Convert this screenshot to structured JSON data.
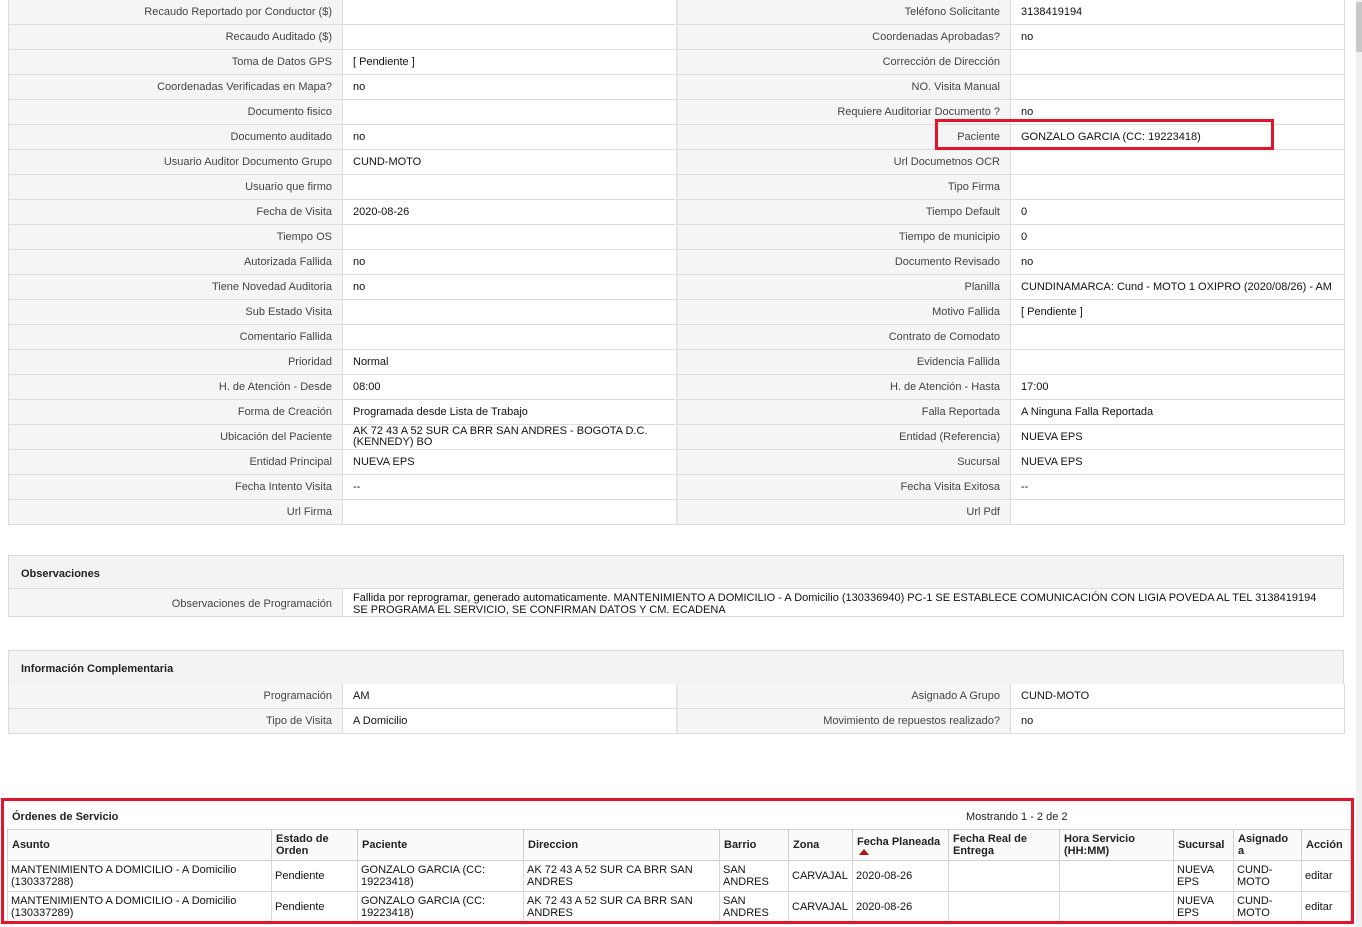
{
  "details": [
    [
      "Recaudo Reportado por Conductor ($)",
      "",
      "Teléfono Solicitante",
      "3138419194"
    ],
    [
      "Recaudo Auditado ($)",
      "",
      "Coordenadas Aprobadas?",
      " no"
    ],
    [
      "Toma de Datos GPS",
      "[ Pendiente ]",
      "Corrección de Dirección",
      ""
    ],
    [
      "Coordenadas Verificadas en Mapa?",
      " no",
      "NO. Visita Manual",
      ""
    ],
    [
      "Documento fisico",
      "",
      "Requiere Auditoriar Documento ?",
      " no"
    ],
    [
      "Documento auditado",
      " no",
      "Paciente",
      "GONZALO GARCIA (CC: 19223418)"
    ],
    [
      "Usuario Auditor Documento Grupo",
      "CUND-MOTO",
      "Url Documetnos OCR",
      ""
    ],
    [
      "Usuario que firmo",
      "",
      "Tipo Firma",
      ""
    ],
    [
      "Fecha de Visita",
      " 2020-08-26",
      "Tiempo Default",
      "0"
    ],
    [
      "Tiempo OS",
      "",
      "Tiempo de municipio",
      "0"
    ],
    [
      "Autorizada Fallida",
      " no",
      "Documento Revisado",
      " no"
    ],
    [
      "Tiene Novedad Auditoria",
      " no",
      "Planilla",
      "CUNDINAMARCA: Cund - MOTO 1 OXIPRO (2020/08/26) - AM"
    ],
    [
      "Sub Estado Visita",
      "",
      "Motivo Fallida",
      "[ Pendiente ]"
    ],
    [
      "Comentario Fallida",
      "",
      "Contrato de Comodato",
      ""
    ],
    [
      "Prioridad",
      "Normal",
      "Evidencia Fallida",
      ""
    ],
    [
      "H. de Atención - Desde",
      "08:00",
      "H. de Atención - Hasta",
      "17:00"
    ],
    [
      "Forma de Creación",
      "Programada desde Lista de Trabajo",
      "Falla Reportada",
      "A Ninguna Falla Reportada"
    ],
    [
      "Ubicación del Paciente",
      "AK 72 43 A 52 SUR CA BRR SAN ANDRES - BOGOTA D.C. (KENNEDY) BO",
      "Entidad (Referencia)",
      "NUEVA EPS"
    ],
    [
      "Entidad Principal",
      "NUEVA EPS",
      "Sucursal",
      "NUEVA EPS"
    ],
    [
      "Fecha Intento Visita",
      " --",
      "Fecha Visita Exitosa",
      " --"
    ],
    [
      "Url Firma",
      "",
      "Url Pdf",
      ""
    ]
  ],
  "observaciones": {
    "title": "Observaciones",
    "label": "Observaciones de Programación",
    "value": "  Fallida por reprogramar, generado automaticamente. MANTENIMIENTO A DOMICILIO - A Domicilio (130336940) PC-1 SE ESTABLECE COMUNICACIÓN CON LIGIA POVEDA AL TEL 3138419194 SE PROGRAMA EL SERVICIO, SE CONFIRMAN DATOS Y CM. ECADENA"
  },
  "complementaria": {
    "title": "Información Complementaria",
    "rows": [
      [
        "Programación",
        "AM",
        "Asignado A Grupo",
        "CUND-MOTO"
      ],
      [
        "Tipo de Visita",
        "A Domicilio",
        "Movimiento de repuestos realizado?",
        " no"
      ]
    ]
  },
  "ordenes": {
    "title": "Órdenes de Servicio",
    "count": "Mostrando 1 - 2 de 2",
    "headers": [
      "Asunto",
      "Estado de Orden",
      "Paciente",
      "Direccion",
      "Barrio",
      "Zona",
      "Fecha Planeada",
      "Fecha Real de Entrega",
      "Hora Servicio (HH:MM)",
      "Sucursal",
      "Asignado a",
      "Acción"
    ],
    "rows": [
      [
        "MANTENIMIENTO A DOMICILIO - A Domicilio (130337288)",
        "Pendiente",
        "GONZALO GARCIA (CC: 19223418)",
        "AK 72 43 A 52 SUR CA BRR SAN ANDRES",
        "SAN ANDRES",
        "CARVAJAL",
        "2020-08-26",
        "",
        "",
        "NUEVA EPS",
        "CUND-MOTO",
        "editar"
      ],
      [
        "MANTENIMIENTO A DOMICILIO - A Domicilio (130337289)",
        "Pendiente",
        "GONZALO GARCIA (CC: 19223418)",
        "AK 72 43 A 52 SUR CA BRR SAN ANDRES",
        "SAN ANDRES",
        "CARVAJAL",
        "2020-08-26",
        "",
        "",
        "NUEVA EPS",
        "CUND-MOTO",
        "editar"
      ]
    ]
  },
  "colors": {
    "highlight": "#e3152b",
    "label_bg": "#f5f5f5",
    "sort_arrow": "#b01010"
  },
  "icons": {
    "sort": "sort-asc-icon"
  }
}
